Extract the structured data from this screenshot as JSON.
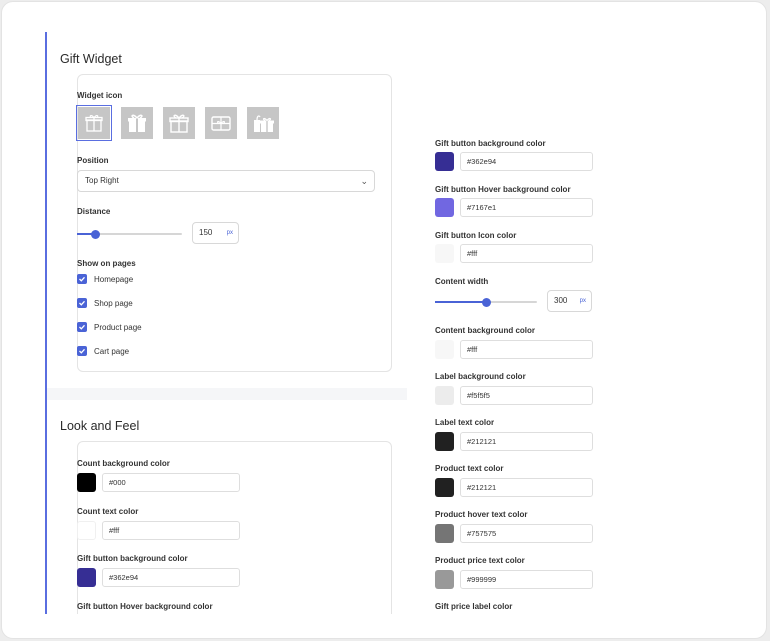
{
  "gift_widget": {
    "title": "Gift Widget",
    "widget_icon_label": "Widget icon",
    "icons": [
      {
        "name": "gift-box-icon",
        "selected": true
      },
      {
        "name": "gift-present-icon",
        "selected": false
      },
      {
        "name": "gift-ribbon-icon",
        "selected": false
      },
      {
        "name": "gift-card-icon",
        "selected": false
      },
      {
        "name": "gift-bag-icon",
        "selected": false
      }
    ],
    "position_label": "Position",
    "position_value": "Top Right",
    "distance_label": "Distance",
    "distance_value": "150",
    "distance_unit": "px",
    "distance_fraction": 0.18,
    "show_on_pages_label": "Show on pages",
    "pages": [
      {
        "label": "Homepage",
        "checked": true
      },
      {
        "label": "Shop page",
        "checked": true
      },
      {
        "label": "Product page",
        "checked": true
      },
      {
        "label": "Cart page",
        "checked": true
      }
    ]
  },
  "look_and_feel": {
    "title": "Look and Feel",
    "fields": [
      {
        "label": "Count background color",
        "value": "#000",
        "color": "#000000"
      },
      {
        "label": "Count text color",
        "value": "#fff",
        "color": "#ffffff"
      },
      {
        "label": "Gift button background color",
        "value": "#362e94",
        "color": "#362e94"
      }
    ],
    "cutoff_label": "Gift button Hover background color"
  },
  "right_panel": {
    "fields": [
      {
        "label": "Gift button background color",
        "value": "#362e94",
        "color": "#362e94"
      },
      {
        "label": "Gift button Hover background color",
        "value": "#7167e1",
        "color": "#7167e1"
      },
      {
        "label": "Gift button Icon color",
        "value": "#fff",
        "color": "#ffffff"
      }
    ],
    "content_width_label": "Content width",
    "content_width_value": "300",
    "content_width_unit": "px",
    "content_width_fraction": 0.5,
    "fields_after": [
      {
        "label": "Content background color",
        "value": "#fff",
        "color": "#ffffff"
      },
      {
        "label": "Label background color",
        "value": "#f5f5f5",
        "color": "#f5f5f5"
      },
      {
        "label": "Label text color",
        "value": "#212121",
        "color": "#212121"
      },
      {
        "label": "Product text color",
        "value": "#212121",
        "color": "#212121"
      },
      {
        "label": "Product hover text color",
        "value": "#757575",
        "color": "#757575"
      },
      {
        "label": "Product price text color",
        "value": "#999999",
        "color": "#999999"
      }
    ],
    "cutoff_label": "Gift price label color"
  },
  "colors": {
    "accent": "#4a63d6",
    "border_accent": "#5a6ee0"
  }
}
